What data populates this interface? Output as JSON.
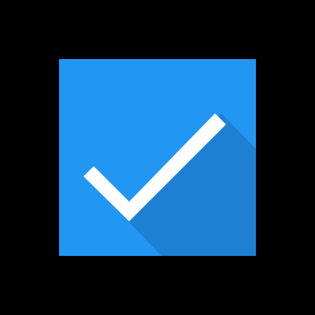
{
  "icon": {
    "name": "checked-checkbox-icon",
    "checked": true,
    "colors": {
      "background": "#000000",
      "box": "#2196F3",
      "shadow": "#1E80D2",
      "checkmark": "#FFFFFF"
    }
  }
}
